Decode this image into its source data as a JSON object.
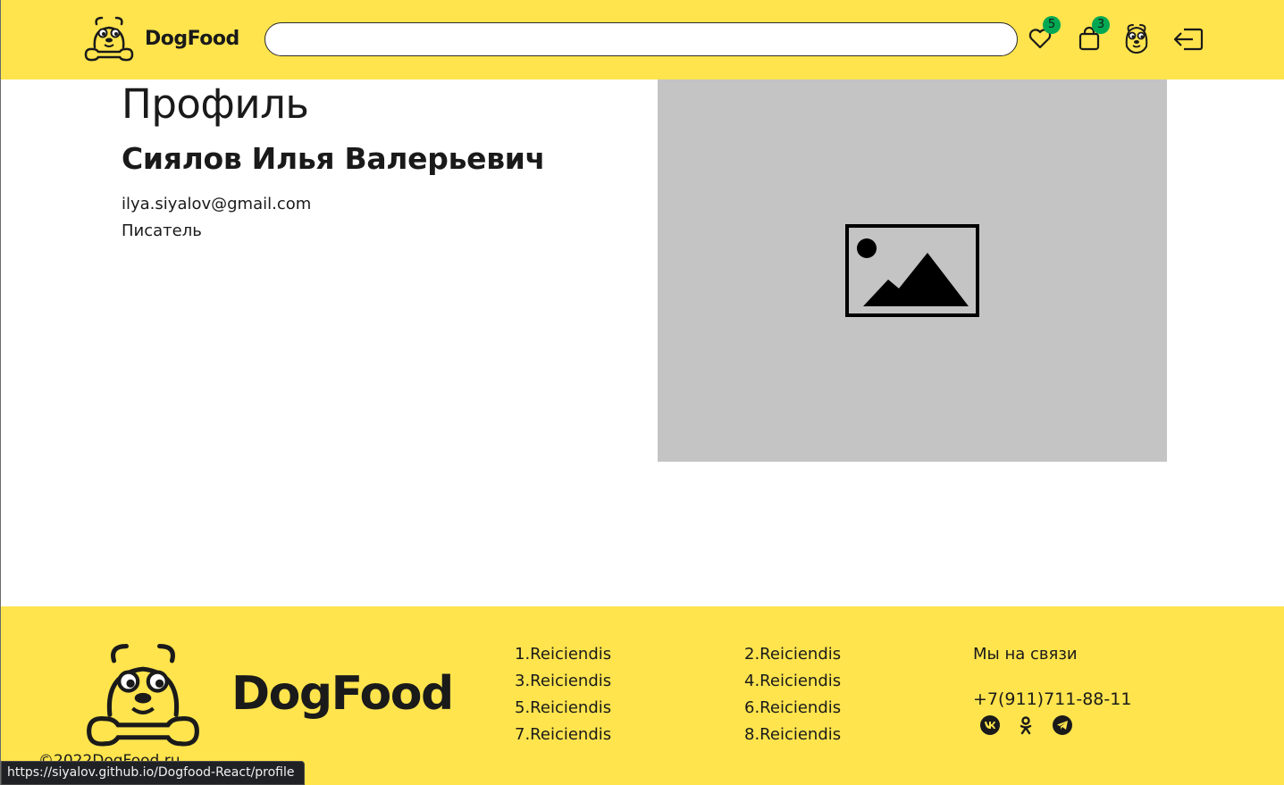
{
  "header": {
    "logo_text": "DogFood",
    "search": {
      "value": "",
      "placeholder": ""
    },
    "favorites_count": "5",
    "cart_count": "3"
  },
  "profile": {
    "title": "Профиль",
    "name": "Сиялов Илья Валерьевич",
    "email": "ilya.siyalov@gmail.com",
    "about": "Писатель"
  },
  "footer": {
    "logo_text": "DogFood",
    "copyright": "©2022DogFood.ru",
    "links_col1": [
      "1.Reiciendis",
      "3.Reiciendis",
      "5.Reiciendis",
      "7.Reiciendis"
    ],
    "links_col2": [
      "2.Reiciendis",
      "4.Reiciendis",
      "6.Reiciendis",
      "8.Reiciendis"
    ],
    "contact_title": "Мы на связи",
    "phone": "+7(911)711-88-11",
    "socials": [
      "vk-icon",
      "ok-icon",
      "telegram-icon"
    ]
  },
  "status_bar": {
    "url": "https://siyalov.github.io/Dogfood-React/profile"
  },
  "colors": {
    "brand_yellow": "#FFE44D",
    "badge_green": "#00A853",
    "placeholder_gray": "#C4C4C4"
  }
}
